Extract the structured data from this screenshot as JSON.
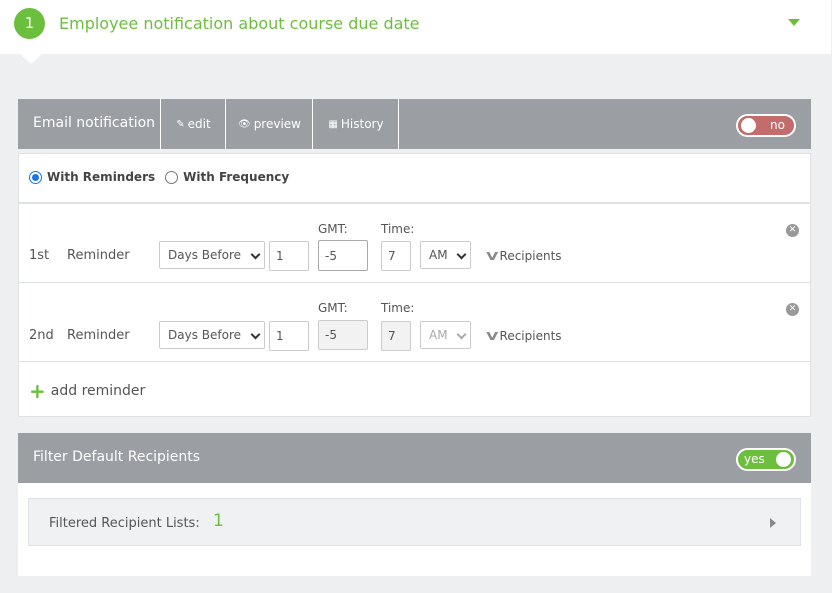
{
  "step": {
    "number": "1",
    "title": "Employee notification about course due date"
  },
  "email_bar": {
    "title": "Email notification",
    "tabs": [
      {
        "label": "edit",
        "icon": "edit-icon"
      },
      {
        "label": "preview",
        "icon": "eye-icon"
      },
      {
        "label": "History",
        "icon": "calendar-icon"
      }
    ],
    "toggle": {
      "label": "no",
      "state": "off",
      "color": "#c26c6c"
    }
  },
  "mode": {
    "options": [
      {
        "label": "With Reminders",
        "checked": true
      },
      {
        "label": "With Frequency",
        "checked": false
      }
    ]
  },
  "columns": {
    "gmt": "GMT:",
    "time": "Time:"
  },
  "reminders": [
    {
      "ordinal": "1st",
      "label": "Reminder",
      "unit": "Days Before",
      "count": "1",
      "gmt": "-5",
      "time": "7",
      "ampm": "AM",
      "recipients": "Recipients",
      "editable": true
    },
    {
      "ordinal": "2nd",
      "label": "Reminder",
      "unit": "Days Before",
      "count": "1",
      "gmt": "-5",
      "time": "7",
      "ampm": "AM",
      "recipients": "Recipients",
      "editable": false
    }
  ],
  "add_reminder": {
    "label": "add reminder"
  },
  "filter_bar": {
    "title": "Filter Default Recipients",
    "toggle": {
      "label": "yes",
      "state": "on",
      "color": "#6cbf3c"
    }
  },
  "filtered": {
    "label": "Filtered Recipient Lists:",
    "count": "1"
  },
  "colors": {
    "accent": "#6cbf3c",
    "bar": "#9b9ea3",
    "background": "#eeeff1"
  }
}
